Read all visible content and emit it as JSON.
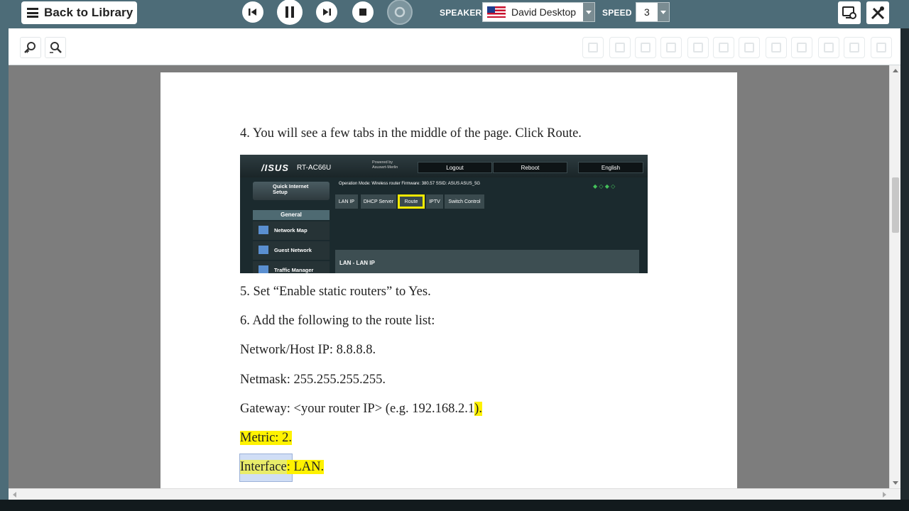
{
  "topbar": {
    "back_label": "Back to Library",
    "speaker_label": "SPEAKER",
    "speaker_value": "David Desktop",
    "speed_label": "SPEED",
    "speed_value": "3"
  },
  "document": {
    "step4": "4. You will see a few tabs in the middle of the page. Click Route.",
    "step5": "5. Set “Enable static routers” to Yes.",
    "step6": "6. Add the following to the route list:",
    "network_host": "Network/Host IP: 8.8.8.8.",
    "netmask": "Netmask: 255.255.255.255.",
    "gateway_main": "Gateway: <your router IP> (e.g. 192.168.2.1",
    "gateway_tail": ").",
    "metric": "Metric: 2.",
    "interface_label": "Interface",
    "interface_value": ": LAN."
  },
  "router_screenshot": {
    "brand": "/ISUS",
    "model": "RT-AC66U",
    "powered_by": "Powered by\nAsuswrt-Merlin",
    "logout": "Logout",
    "reboot": "Reboot",
    "language": "English",
    "quick_setup": "Quick Internet\nSetup",
    "general": "General",
    "nav_items": [
      "Network Map",
      "Guest Network",
      "Traffic Manager"
    ],
    "operation_mode": "Operation Mode: Wireless router  Firmware: 380.57  SSID: ASUS  ASUS_5G",
    "tabs": [
      "LAN IP",
      "DHCP Server",
      "Route",
      "IPTV",
      "Switch Control"
    ],
    "panel_title": "LAN - LAN IP"
  },
  "colors": {
    "toolbar": "#4d6c78",
    "highlight": "#fff200",
    "viewer_bg": "#7d7d7d"
  }
}
